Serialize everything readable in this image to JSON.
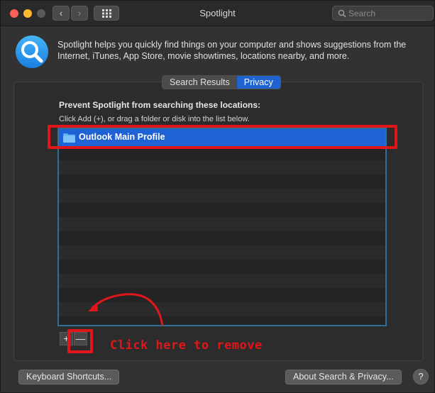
{
  "window": {
    "title": "Spotlight",
    "nav_back": "‹",
    "nav_forward": "›",
    "search_placeholder": "Search"
  },
  "header": {
    "description": "Spotlight helps you quickly find things on your computer and shows suggestions from the Internet, iTunes, App Store, movie showtimes, locations nearby, and more."
  },
  "tabs": [
    {
      "label": "Search Results",
      "active": false
    },
    {
      "label": "Privacy",
      "active": true
    }
  ],
  "privacy": {
    "heading": "Prevent Spotlight from searching these locations:",
    "hint": "Click Add (+), or drag a folder or disk into the list below.",
    "items": [
      {
        "label": "Outlook Main Profile",
        "selected": true
      }
    ],
    "add_label": "+",
    "remove_label": "—"
  },
  "annotation": {
    "text": "Click here to remove",
    "color": "#e0161b"
  },
  "footer": {
    "keyboard_shortcuts": "Keyboard Shortcuts...",
    "about": "About Search & Privacy...",
    "help": "?"
  },
  "colors": {
    "accent": "#1e62d6",
    "annotation_red": "#e0161b"
  }
}
